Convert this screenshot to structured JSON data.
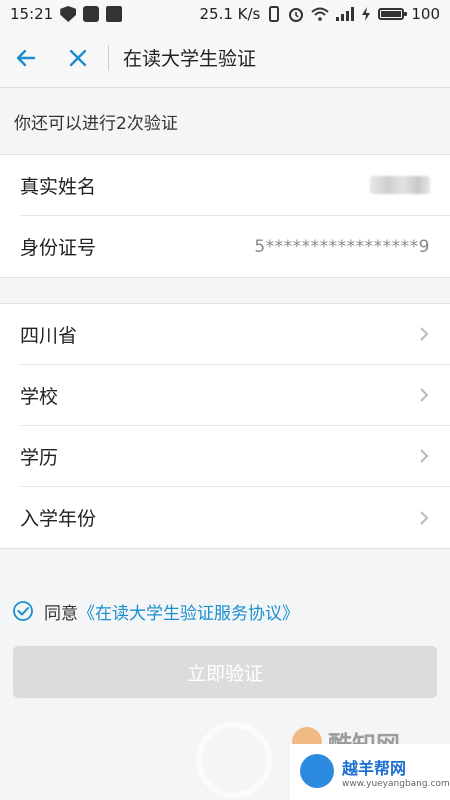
{
  "status_bar": {
    "time": "15:21",
    "speed": "25.1 K/s",
    "battery": "100"
  },
  "nav": {
    "title": "在读大学生验证"
  },
  "notice": "你还可以进行2次验证",
  "identity": [
    {
      "label": "真实姓名",
      "value": ""
    },
    {
      "label": "身份证号",
      "value": "5*****************9"
    }
  ],
  "fields": [
    {
      "label": "四川省"
    },
    {
      "label": "学校"
    },
    {
      "label": "学历"
    },
    {
      "label": "入学年份"
    }
  ],
  "agreement": {
    "prefix": "同意",
    "link": "《在读大学生验证服务协议》",
    "checked": true
  },
  "submit_label": "立即验证",
  "colors": {
    "accent": "#1a8fd0",
    "disabled_button": "#dcdcdc"
  },
  "watermarks": {
    "left": "酷知网",
    "right_title": "越羊帮网",
    "right_url": "www.yueyangbang.com"
  }
}
